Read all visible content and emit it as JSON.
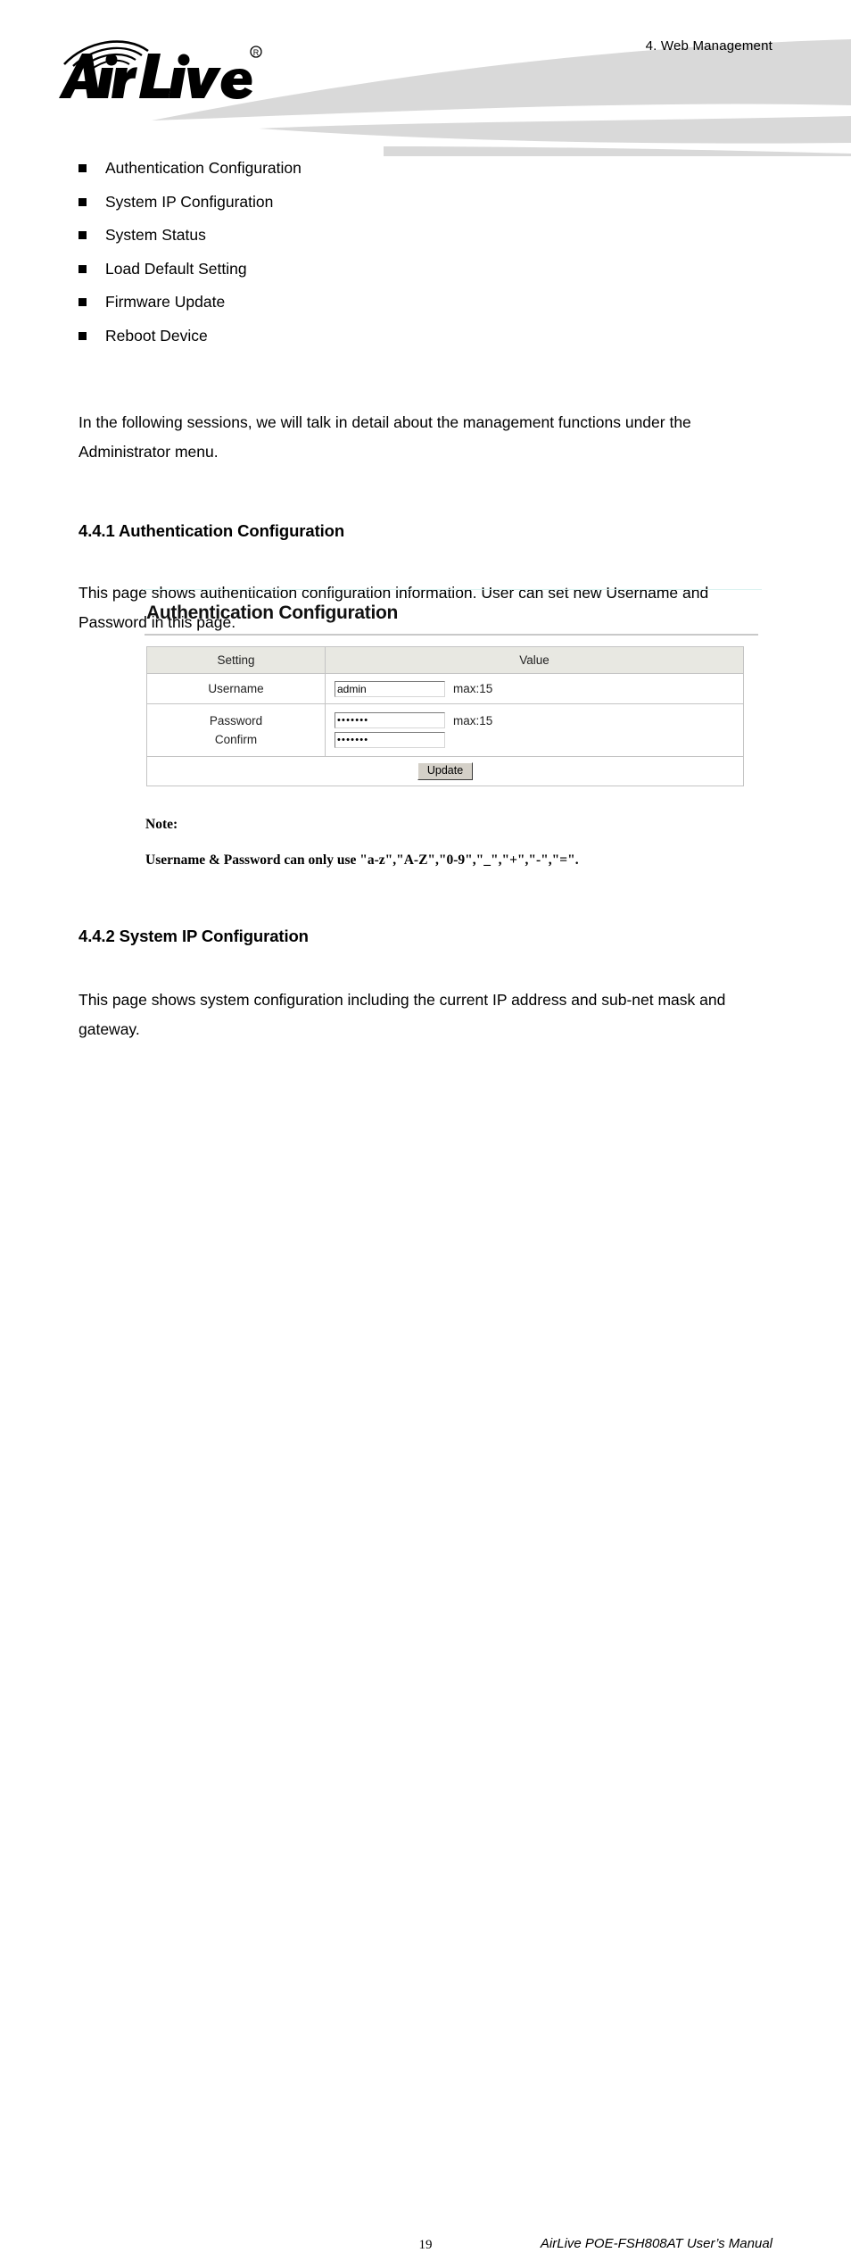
{
  "header": {
    "chapter": "4.  Web  Management",
    "logo_text": "AirLive",
    "logo_trademark": "®"
  },
  "bullets": [
    {
      "label": "Authentication Configuration"
    },
    {
      "label": "System IP Configuration"
    },
    {
      "label": "System Status"
    },
    {
      "label": "Load Default Setting"
    },
    {
      "label": "Firmware Update"
    },
    {
      "label": "Reboot Device"
    }
  ],
  "intro_paragraph": "In the following sessions, we will talk in detail about the management functions under the Administrator menu.",
  "section_441": {
    "heading": "4.4.1 Authentication Configuration",
    "paragraph": "This page shows authentication configuration information. User can set new Username and Password in this page."
  },
  "embedded_ui": {
    "title": "Authentication Configuration",
    "table": {
      "headers": [
        "Setting",
        "Value"
      ],
      "rows": [
        {
          "setting": "Username",
          "input_value": "admin",
          "max_note": "max:15"
        },
        {
          "setting_line_1": "Password",
          "setting_line_2": "Confirm",
          "password_value": "•••••••",
          "confirm_value": "•••••••",
          "max_note": "max:15"
        }
      ],
      "action_button": "Update"
    }
  },
  "note": {
    "title": "Note:",
    "text": "Username & Password can only use \"a-z\",\"A-Z\",\"0-9\",\"_\",\"+\",\"-\",\"=\"."
  },
  "section_442": {
    "heading": "4.4.2 System IP Configuration",
    "paragraph": "This page shows system configuration including the current IP address and sub-net mask and gateway."
  },
  "footer": {
    "page_number": "19",
    "manual_title": "AirLive POE-FSH808AT User’s Manual"
  },
  "colors": {
    "swoosh": "#d9d9d9",
    "table_header_bg": "#e8e8e2",
    "table_border": "#c4c4c4",
    "button_face": "#d4d0c8",
    "embed_topline": "#d8f2f0"
  }
}
